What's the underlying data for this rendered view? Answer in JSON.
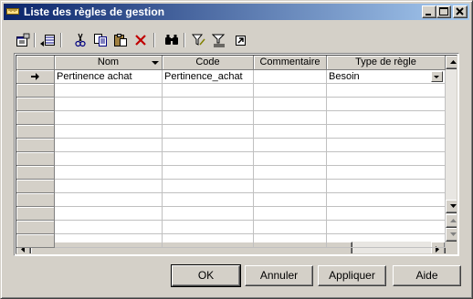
{
  "window": {
    "title": "Liste des règles de gestion",
    "title_icon": "ruler-icon",
    "controls": [
      "minimize-icon",
      "maximize-icon",
      "close-icon"
    ]
  },
  "toolbar": {
    "tools": [
      {
        "name": "properties-icon"
      },
      {
        "name": "add-row-icon"
      },
      {
        "name": "cut-icon"
      },
      {
        "name": "copy-icon"
      },
      {
        "name": "paste-icon"
      },
      {
        "name": "delete-icon"
      },
      {
        "name": "find-icon"
      },
      {
        "name": "filter-icon"
      },
      {
        "name": "clear-filter-icon"
      },
      {
        "name": "open-object-icon"
      }
    ]
  },
  "grid": {
    "columns": [
      {
        "label": "Nom",
        "sorted": true
      },
      {
        "label": "Code",
        "sorted": false
      },
      {
        "label": "Commentaire",
        "sorted": false
      },
      {
        "label": "Type de règle",
        "sorted": false
      }
    ],
    "rows": [
      {
        "current": true,
        "cells": [
          "Pertinence achat",
          "Pertinence_achat",
          "",
          "Besoin"
        ]
      }
    ],
    "empty_row_count": 12
  },
  "buttons": {
    "ok": "OK",
    "cancel": "Annuler",
    "apply": "Appliquer",
    "help": "Aide"
  },
  "colors": {
    "titlebar_start": "#0a246a",
    "titlebar_end": "#a6caf0",
    "face": "#d4d0c8"
  }
}
